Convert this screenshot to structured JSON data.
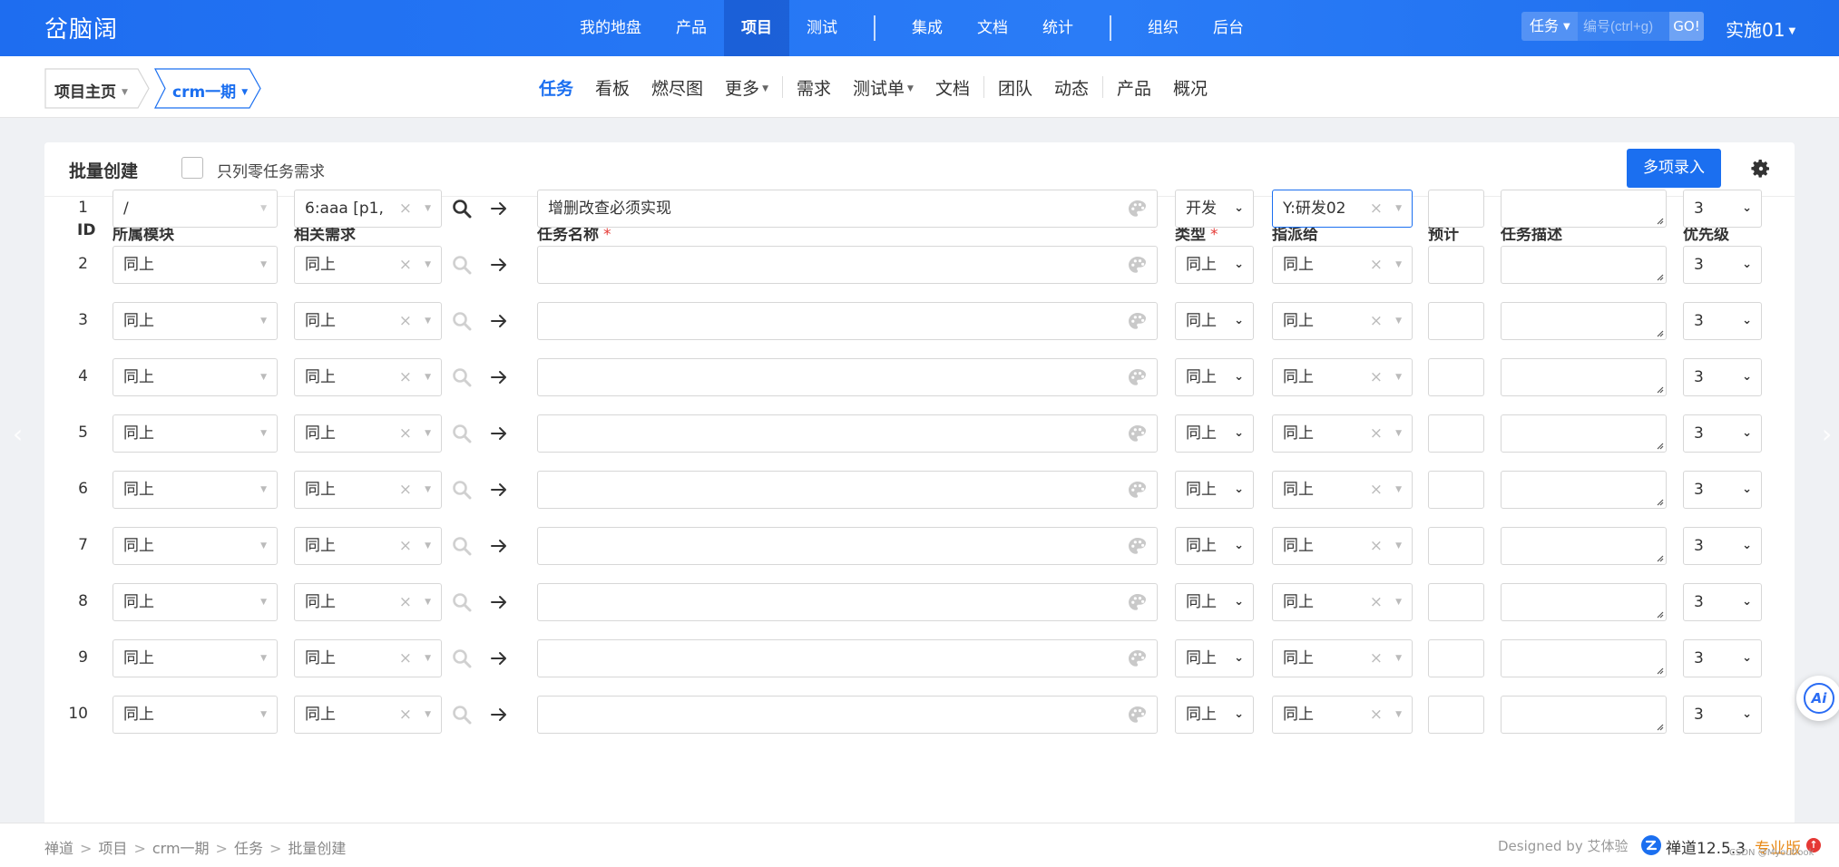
{
  "app": {
    "logo": "岔脑阔",
    "nav": [
      "我的地盘",
      "产品",
      "项目",
      "测试",
      "集成",
      "文档",
      "统计",
      "组织",
      "后台"
    ],
    "nav_active": "项目",
    "search": {
      "type": "任务",
      "placeholder": "编号(ctrl+g)",
      "go": "GO!"
    },
    "user": "实施01"
  },
  "breadcrumb": {
    "home": "项目主页",
    "project": "crm一期"
  },
  "subnav": {
    "items": [
      {
        "label": "任务",
        "active": true
      },
      {
        "label": "看板"
      },
      {
        "label": "燃尽图"
      },
      {
        "label": "更多",
        "dropdown": true
      },
      {
        "label": "需求"
      },
      {
        "label": "测试单",
        "dropdown": true
      },
      {
        "label": "文档"
      },
      {
        "label": "团队"
      },
      {
        "label": "动态"
      },
      {
        "label": "产品"
      },
      {
        "label": "概况"
      }
    ]
  },
  "panel": {
    "title": "批量创建",
    "checkbox_label": "只列零任务需求",
    "multi_button": "多项录入"
  },
  "columns": {
    "id": "ID",
    "module": "所属模块",
    "story": "相关需求",
    "name": "任务名称",
    "type": "类型",
    "assign": "指派给",
    "estimate": "预计",
    "desc": "任务描述",
    "priority": "优先级",
    "required_mark": "*"
  },
  "rows": [
    {
      "id": "1",
      "module": "/",
      "story": "6:aaa [p1,",
      "name": "增删改查必须实现",
      "type": "开发",
      "assign": "Y:研发02",
      "priority": "3"
    },
    {
      "id": "2",
      "module": "同上",
      "story": "同上",
      "name": "",
      "type": "同上",
      "assign": "同上",
      "priority": "3"
    },
    {
      "id": "3",
      "module": "同上",
      "story": "同上",
      "name": "",
      "type": "同上",
      "assign": "同上",
      "priority": "3"
    },
    {
      "id": "4",
      "module": "同上",
      "story": "同上",
      "name": "",
      "type": "同上",
      "assign": "同上",
      "priority": "3"
    },
    {
      "id": "5",
      "module": "同上",
      "story": "同上",
      "name": "",
      "type": "同上",
      "assign": "同上",
      "priority": "3"
    },
    {
      "id": "6",
      "module": "同上",
      "story": "同上",
      "name": "",
      "type": "同上",
      "assign": "同上",
      "priority": "3"
    },
    {
      "id": "7",
      "module": "同上",
      "story": "同上",
      "name": "",
      "type": "同上",
      "assign": "同上",
      "priority": "3"
    },
    {
      "id": "8",
      "module": "同上",
      "story": "同上",
      "name": "",
      "type": "同上",
      "assign": "同上",
      "priority": "3"
    },
    {
      "id": "9",
      "module": "同上",
      "story": "同上",
      "name": "",
      "type": "同上",
      "assign": "同上",
      "priority": "3"
    },
    {
      "id": "10",
      "module": "同上",
      "story": "同上",
      "name": "",
      "type": "同上",
      "assign": "同上",
      "priority": "3"
    }
  ],
  "footer": {
    "crumbs": [
      "禅道",
      "项目",
      "crm一期",
      "任务",
      "批量创建"
    ],
    "crumb_sep": ">",
    "designed_by": "Designed by 艾体验",
    "version": "禅道12.5.3",
    "edition": "专业版",
    "watermark": "CSDN @Myoutlook"
  },
  "ai_button": "Ai",
  "colors": {
    "primary": "#1b6ff0",
    "topbar": "#1e6df0",
    "required": "#e53935",
    "edition": "#e88a18"
  },
  "icons": [
    "search-icon",
    "arrow-right-icon",
    "palette-icon",
    "gear-icon",
    "chevron-down-icon",
    "clear-icon"
  ]
}
